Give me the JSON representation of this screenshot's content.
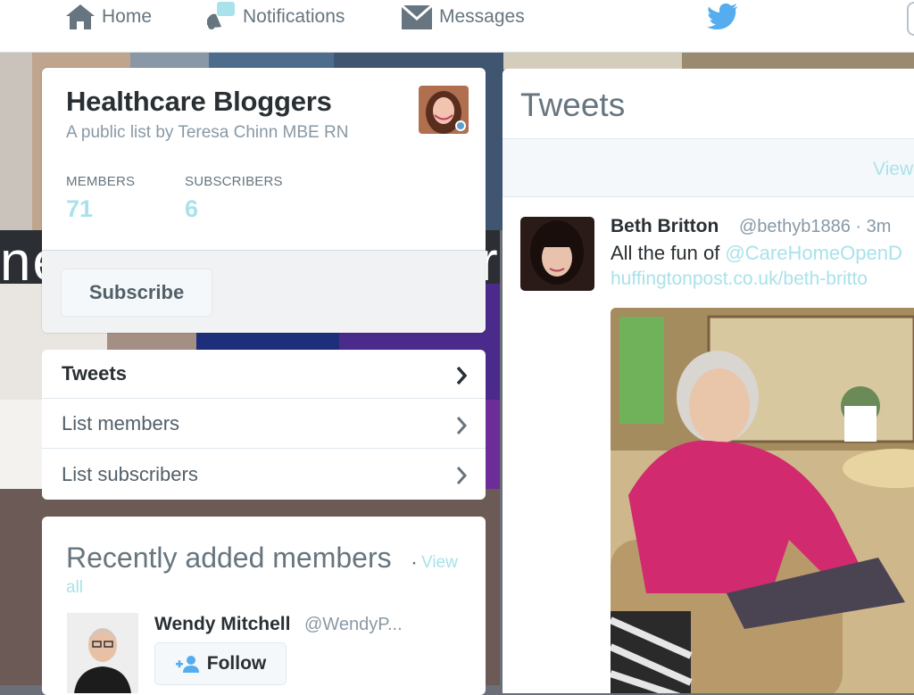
{
  "nav": {
    "home_label": "Home",
    "notifications_label": "Notifications",
    "notifications_badge": "",
    "messages_label": "Messages"
  },
  "collage": {
    "overlay_text": "ne",
    "overlay_text_right": "r"
  },
  "list": {
    "title": "Healthcare Bloggers",
    "byline": "A public list by Teresa Chinn MBE RN",
    "members_label": "MEMBERS",
    "members_count": "71",
    "subscribers_label": "SUBSCRIBERS",
    "subscribers_count": "6",
    "subscribe_label": "Subscribe"
  },
  "menu": {
    "items": [
      {
        "label": "Tweets",
        "active": true
      },
      {
        "label": "List members",
        "active": false
      },
      {
        "label": "List subscribers",
        "active": false
      }
    ]
  },
  "recent": {
    "title": "Recently added members",
    "separator": "·",
    "view_all_part1": "View",
    "view_all_part2": "all",
    "member": {
      "name": "Wendy Mitchell",
      "handle": "@WendyP...",
      "follow_label": "Follow"
    }
  },
  "tweets": {
    "heading": "Tweets",
    "new_tweets_text": "View",
    "tweet": {
      "name": "Beth Britton",
      "handle": "@bethyb1886 · 3m",
      "text_prefix": "All the fun of ",
      "mention": "@CareHomeOpenD",
      "link": "huffingtonpost.co.uk/beth-britto"
    }
  },
  "colors": {
    "accent_link": "#a9e2ea",
    "twitter_blue": "#55acee",
    "text_dark": "#292f33",
    "text_muted": "#66757f"
  }
}
